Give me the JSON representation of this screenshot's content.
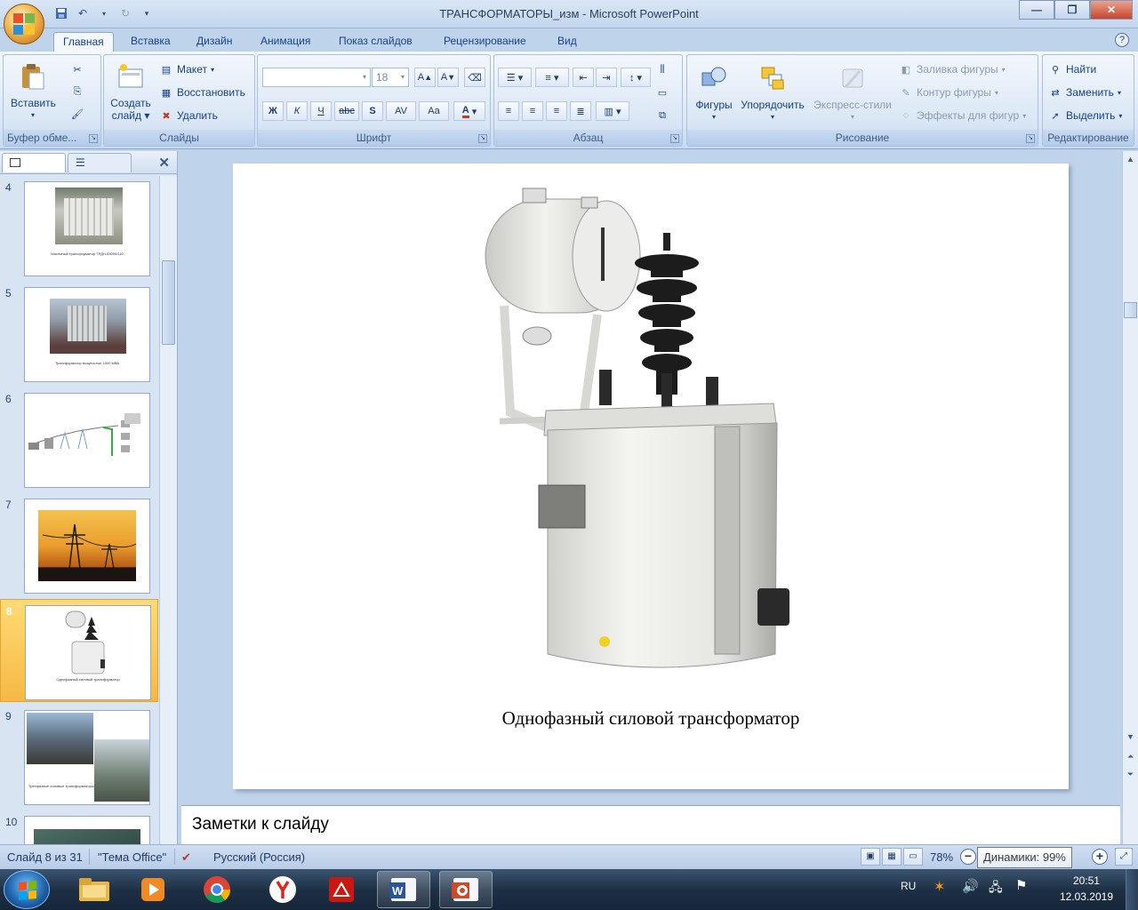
{
  "window": {
    "title": "ТРАНСФОРМАТОРЫ_изм - Microsoft PowerPoint"
  },
  "ribbon_tabs": [
    "Главная",
    "Вставка",
    "Дизайн",
    "Анимация",
    "Показ слайдов",
    "Рецензирование",
    "Вид"
  ],
  "ribbon": {
    "clipboard": {
      "label": "Буфер обме...",
      "paste": "Вставить"
    },
    "slides": {
      "label": "Слайды",
      "new_slide_1": "Создать",
      "new_slide_2": "слайд",
      "layout": "Макет",
      "reset": "Восстановить",
      "delete": "Удалить"
    },
    "font": {
      "label": "Шрифт",
      "size": "18",
      "bold": "Ж",
      "italic": "К",
      "underline": "Ч",
      "strike": "abc",
      "shadow": "S",
      "spacing": "AV",
      "case": "Aa"
    },
    "paragraph": {
      "label": "Абзац"
    },
    "drawing": {
      "label": "Рисование",
      "shapes": "Фигуры",
      "arrange": "Упорядочить",
      "quick_styles": "Экспресс-стили",
      "fill": "Заливка фигуры",
      "outline": "Контур фигуры",
      "effects": "Эффекты для фигур"
    },
    "editing": {
      "label": "Редактирование",
      "find": "Найти",
      "replace": "Заменить",
      "select": "Выделить"
    }
  },
  "slide_thumbnails": [
    {
      "number": "4",
      "caption": "Масляный трансформатор ТРДН-63000/110"
    },
    {
      "number": "5",
      "caption": "Трансформатор мощностью 1000 МВА"
    },
    {
      "number": "6",
      "caption": ""
    },
    {
      "number": "7",
      "caption": ""
    },
    {
      "number": "8",
      "caption": "Однофазный силовой трансформатор"
    },
    {
      "number": "9",
      "caption": "Трёхфазные силовые трансформаторы"
    },
    {
      "number": "10",
      "caption": ""
    }
  ],
  "current_slide": {
    "caption": "Однофазный силовой трансформатор"
  },
  "notes": {
    "placeholder": "Заметки к слайду"
  },
  "status": {
    "slide_counter": "Слайд 8 из 31",
    "theme": "\"Тема Office\"",
    "language": "Русский (Россия)",
    "zoom": "78%",
    "tooltip": "Динамики: 99%"
  },
  "taskbar": {
    "lang": "RU",
    "time": "20:51",
    "date": "12.03.2019"
  },
  "colors": {
    "ribbon_bg": "#dbe7f5",
    "accent": "#15428b",
    "active_thumb": "#f6b845"
  }
}
